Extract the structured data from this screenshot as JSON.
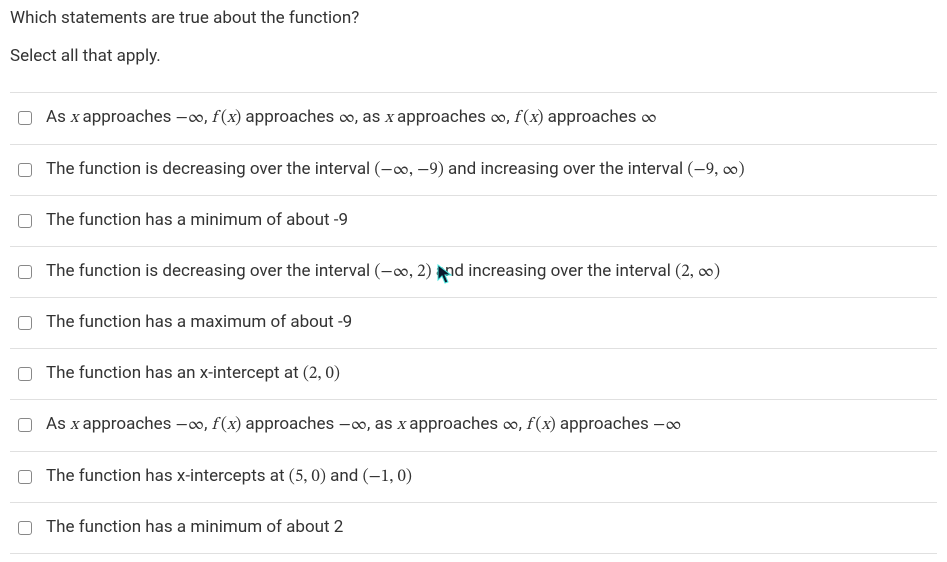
{
  "question": "Which statements are true about the function?",
  "instruction": "Select all that apply.",
  "options": [
    {
      "parts": [
        {
          "t": "text",
          "v": "As "
        },
        {
          "t": "mathit",
          "v": "x"
        },
        {
          "t": "text",
          "v": " approaches "
        },
        {
          "t": "mathrm",
          "v": "−∞"
        },
        {
          "t": "text",
          "v": ", "
        },
        {
          "t": "mathit",
          "v": "f"
        },
        {
          "t": "mathrm",
          "v": " ("
        },
        {
          "t": "mathit",
          "v": "x"
        },
        {
          "t": "mathrm",
          "v": ")"
        },
        {
          "t": "text",
          "v": " approaches "
        },
        {
          "t": "mathrm",
          "v": "∞"
        },
        {
          "t": "text",
          "v": ", as "
        },
        {
          "t": "mathit",
          "v": "x"
        },
        {
          "t": "text",
          "v": " approaches "
        },
        {
          "t": "mathrm",
          "v": "∞"
        },
        {
          "t": "text",
          "v": ", "
        },
        {
          "t": "mathit",
          "v": "f"
        },
        {
          "t": "mathrm",
          "v": " ("
        },
        {
          "t": "mathit",
          "v": "x"
        },
        {
          "t": "mathrm",
          "v": ")"
        },
        {
          "t": "text",
          "v": " approaches "
        },
        {
          "t": "mathrm",
          "v": "∞"
        }
      ]
    },
    {
      "parts": [
        {
          "t": "text",
          "v": "The function is decreasing over the interval "
        },
        {
          "t": "mathrm",
          "v": "(−∞,  −9)"
        },
        {
          "t": "text",
          "v": " and increasing over the interval "
        },
        {
          "t": "mathrm",
          "v": "(−9,  ∞)"
        }
      ]
    },
    {
      "parts": [
        {
          "t": "text",
          "v": "The function has a minimum of about -9"
        }
      ]
    },
    {
      "parts": [
        {
          "t": "text",
          "v": "The function is decreasing over the interval "
        },
        {
          "t": "mathrm",
          "v": "(−∞,  2)"
        },
        {
          "t": "text",
          "v": " and increasing over the interval "
        },
        {
          "t": "mathrm",
          "v": "(2,  ∞)"
        }
      ]
    },
    {
      "parts": [
        {
          "t": "text",
          "v": "The function has a maximum of about -9"
        }
      ]
    },
    {
      "parts": [
        {
          "t": "text",
          "v": "The function has an x-intercept at "
        },
        {
          "t": "mathrm",
          "v": "(2,  0)"
        }
      ]
    },
    {
      "parts": [
        {
          "t": "text",
          "v": "As "
        },
        {
          "t": "mathit",
          "v": "x"
        },
        {
          "t": "text",
          "v": " approaches "
        },
        {
          "t": "mathrm",
          "v": "−∞"
        },
        {
          "t": "text",
          "v": ", "
        },
        {
          "t": "mathit",
          "v": "f"
        },
        {
          "t": "mathrm",
          "v": " ("
        },
        {
          "t": "mathit",
          "v": "x"
        },
        {
          "t": "mathrm",
          "v": ")"
        },
        {
          "t": "text",
          "v": " approaches "
        },
        {
          "t": "mathrm",
          "v": "−∞"
        },
        {
          "t": "text",
          "v": ", as "
        },
        {
          "t": "mathit",
          "v": "x"
        },
        {
          "t": "text",
          "v": " approaches "
        },
        {
          "t": "mathrm",
          "v": "∞"
        },
        {
          "t": "text",
          "v": ", "
        },
        {
          "t": "mathit",
          "v": "f"
        },
        {
          "t": "mathrm",
          "v": " ("
        },
        {
          "t": "mathit",
          "v": "x"
        },
        {
          "t": "mathrm",
          "v": ")"
        },
        {
          "t": "text",
          "v": " approaches "
        },
        {
          "t": "mathrm",
          "v": "−∞"
        }
      ]
    },
    {
      "parts": [
        {
          "t": "text",
          "v": "The function has x-intercepts at "
        },
        {
          "t": "mathrm",
          "v": "(5,  0)"
        },
        {
          "t": "text",
          "v": " and "
        },
        {
          "t": "mathrm",
          "v": "(−1,  0)"
        }
      ]
    },
    {
      "parts": [
        {
          "t": "text",
          "v": "The function has a minimum of about 2"
        }
      ]
    }
  ]
}
